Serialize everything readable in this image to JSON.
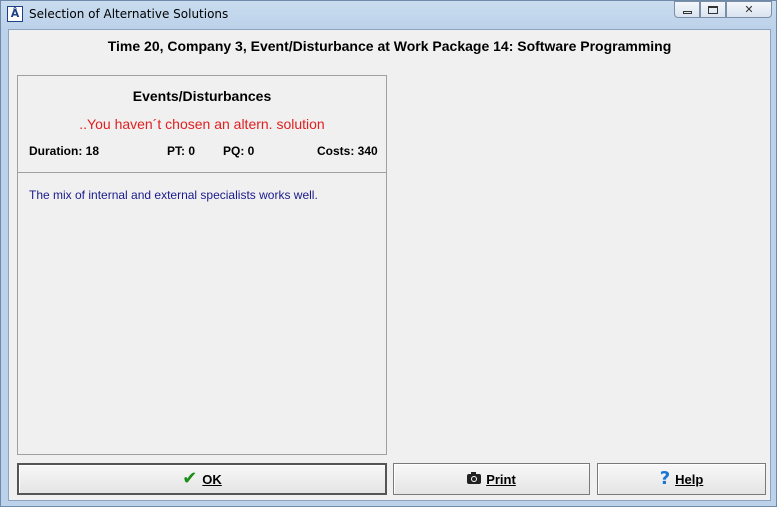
{
  "window": {
    "title": "Selection of Alternative Solutions",
    "icon": "app-icon",
    "icon_glyph": "Å"
  },
  "headline": "Time 20, Company 3, Event/Disturbance at Work Package 14: Software Programming",
  "events": {
    "title": "Events/Disturbances",
    "status": "..You haven´t chosen an altern. solution",
    "status_color": "#e02020",
    "metrics": {
      "duration": "Duration: 18",
      "pt": "PT: 0",
      "pq": "PQ: 0",
      "costs": "Costs: 340"
    }
  },
  "message": "The mix of internal and external specialists works well.",
  "buttons": {
    "ok": {
      "label": "OK",
      "icon": "checkmark-icon",
      "glyph": "✔"
    },
    "print": {
      "label": "Print",
      "icon": "camera-icon"
    },
    "help": {
      "label": "Help",
      "icon": "question-icon",
      "glyph": "?"
    }
  }
}
